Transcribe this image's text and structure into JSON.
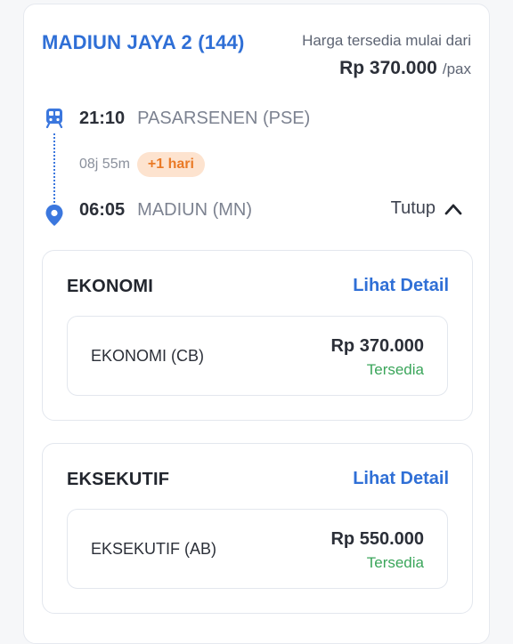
{
  "train": {
    "name": "MADIUN JAYA 2 (144)",
    "price_caption": "Harga tersedia mulai dari",
    "price": "Rp 370.000",
    "price_unit": "/pax"
  },
  "route": {
    "departure": {
      "time": "21:10",
      "station": "PASARSENEN (PSE)"
    },
    "duration": "08j 55m",
    "day_badge": "+1 hari",
    "arrival": {
      "time": "06:05",
      "station": "MADIUN (MN)"
    },
    "toggle_label": "Tutup"
  },
  "classes": [
    {
      "title": "EKONOMI",
      "detail_label": "Lihat Detail",
      "sub": {
        "name": "EKONOMI (CB)",
        "price": "Rp 370.000",
        "status": "Tersedia"
      }
    },
    {
      "title": "EKSEKUTIF",
      "detail_label": "Lihat Detail",
      "sub": {
        "name": "EKSEKUTIF (AB)",
        "price": "Rp 550.000",
        "status": "Tersedia"
      }
    }
  ],
  "colors": {
    "accent": "#2f6fd6",
    "available": "#3aa55a",
    "badge_bg": "#fde3cf",
    "badge_text": "#ea7a26"
  },
  "icons": {
    "train": "train-icon",
    "pin": "location-pin-icon",
    "chevron": "chevron-up-icon"
  }
}
